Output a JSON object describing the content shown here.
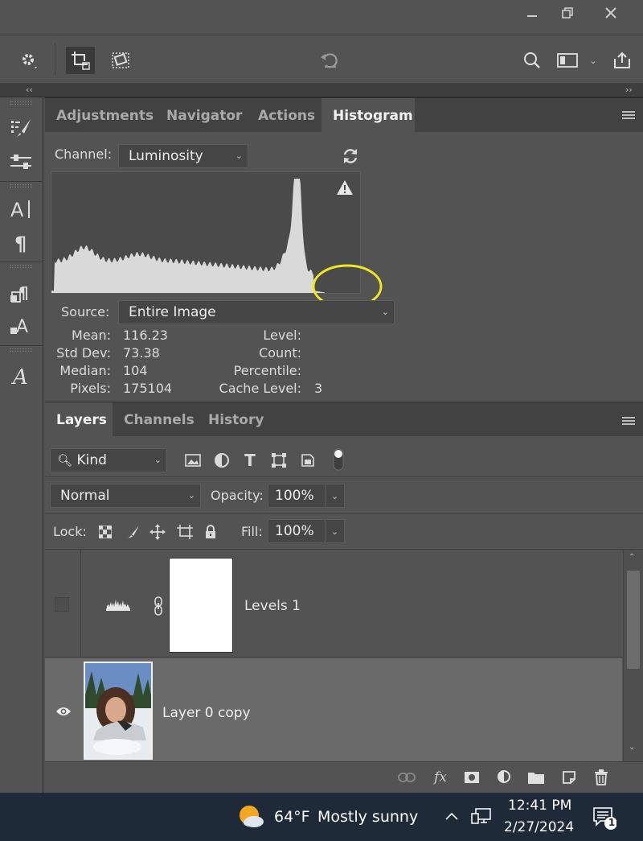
{
  "window": {
    "controls": [
      "minimize-icon",
      "restore-icon",
      "close-icon"
    ]
  },
  "options_bar": {
    "icons": [
      "gear-icon",
      "crop-delete-icon",
      "straighten-icon",
      "reset-icon",
      "search-icon",
      "workspace-icon",
      "share-icon"
    ]
  },
  "left_toolbar": {
    "icons": [
      "brush-presets-icon",
      "adjustment-sliders-icon",
      "character-icon",
      "paragraph-icon",
      "paragraph-styles-icon",
      "character-styles-icon",
      "glyphs-icon"
    ]
  },
  "histogram_panel": {
    "tabs": [
      "Adjustments",
      "Navigator",
      "Actions",
      "Histogram"
    ],
    "active_tab": "Histogram",
    "channel_label": "Channel:",
    "channel_value": "Luminosity",
    "source_label": "Source:",
    "source_value": "Entire Image",
    "stats": {
      "mean_label": "Mean:",
      "mean": "116.23",
      "stddev_label": "Std Dev:",
      "stddev": "73.38",
      "median_label": "Median:",
      "median": "104",
      "pixels_label": "Pixels:",
      "pixels": "175104",
      "level_label": "Level:",
      "count_label": "Count:",
      "percentile_label": "Percentile:",
      "cache_label": "Cache Level:",
      "cache": "3"
    },
    "highlight_color": "#f0e81e"
  },
  "layers_panel": {
    "tabs": [
      "Layers",
      "Channels",
      "History"
    ],
    "active_tab": "Layers",
    "filter_value": "Kind",
    "blend_mode": "Normal",
    "opacity_label": "Opacity:",
    "opacity_value": "100%",
    "lock_label": "Lock:",
    "fill_label": "Fill:",
    "fill_value": "100%",
    "layers": [
      {
        "name": "Levels 1",
        "visible": false
      },
      {
        "name": "Layer 0 copy",
        "visible": true
      }
    ]
  },
  "taskbar": {
    "weather_temp": "64°F",
    "weather_desc": "Mostly sunny",
    "time": "12:41 PM",
    "date": "2/27/2024",
    "notification_count": "1"
  }
}
